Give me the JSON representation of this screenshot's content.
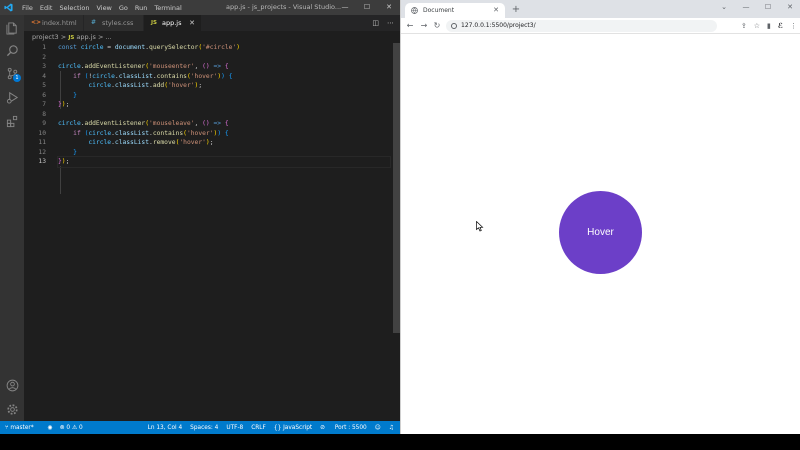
{
  "vscode": {
    "menu": [
      "File",
      "Edit",
      "Selection",
      "View",
      "Go",
      "Run",
      "Terminal"
    ],
    "window_title": "app.js - js_projects - Visual Studio...",
    "tabs": [
      {
        "label": "index.html",
        "icon": "<>"
      },
      {
        "label": "styles.css",
        "icon": "#"
      },
      {
        "label": "app.js",
        "icon": "JS"
      }
    ],
    "scm_badge": "1",
    "breadcrumb": {
      "folder": "project3",
      "sep": ">",
      "js": "JS",
      "file": "app.js",
      "tail": "> ..."
    },
    "line_numbers": [
      "1",
      "2",
      "3",
      "4",
      "5",
      "6",
      "7",
      "8",
      "9",
      "10",
      "11",
      "12",
      "13"
    ],
    "code": {
      "l1": {
        "kw": "const",
        "var": "circle",
        "eq": " = ",
        "obj": "document",
        "fn": "querySelector",
        "str": "'#circle'"
      },
      "l3": {
        "obj": "circle",
        "fn": "addEventListener",
        "str": "'mouseenter'"
      },
      "l4": {
        "kw": "if",
        "neg": "!",
        "obj": "circle",
        "prop": "classList",
        "fn": "contains",
        "str": "'hover'"
      },
      "l5": {
        "obj": "circle",
        "prop": "classList",
        "fn": "add",
        "str": "'hover'"
      },
      "l9": {
        "obj": "circle",
        "fn": "addEventListener",
        "str": "'mouseleave'"
      },
      "l10": {
        "kw": "if",
        "obj": "circle",
        "prop": "classList",
        "fn": "contains",
        "str": "'hover'"
      },
      "l11": {
        "obj": "circle",
        "prop": "classList",
        "fn": "remove",
        "str": "'hover'"
      }
    },
    "status": {
      "branch": "master*",
      "problems": "⊗ 0 ⚠ 0",
      "position": "Ln 13, Col 4",
      "spaces": "Spaces: 4",
      "encoding": "UTF-8",
      "eol": "CRLF",
      "language": "{} JavaScript",
      "port": "Port : 5500"
    }
  },
  "browser": {
    "tab_title": "Document",
    "url": "127.0.0.1:5500/project3/",
    "circle_label": "Hover"
  },
  "colors": {
    "circle": "#6c3fc8",
    "statusbar": "#007acc",
    "editor_bg": "#1e1e1e"
  }
}
